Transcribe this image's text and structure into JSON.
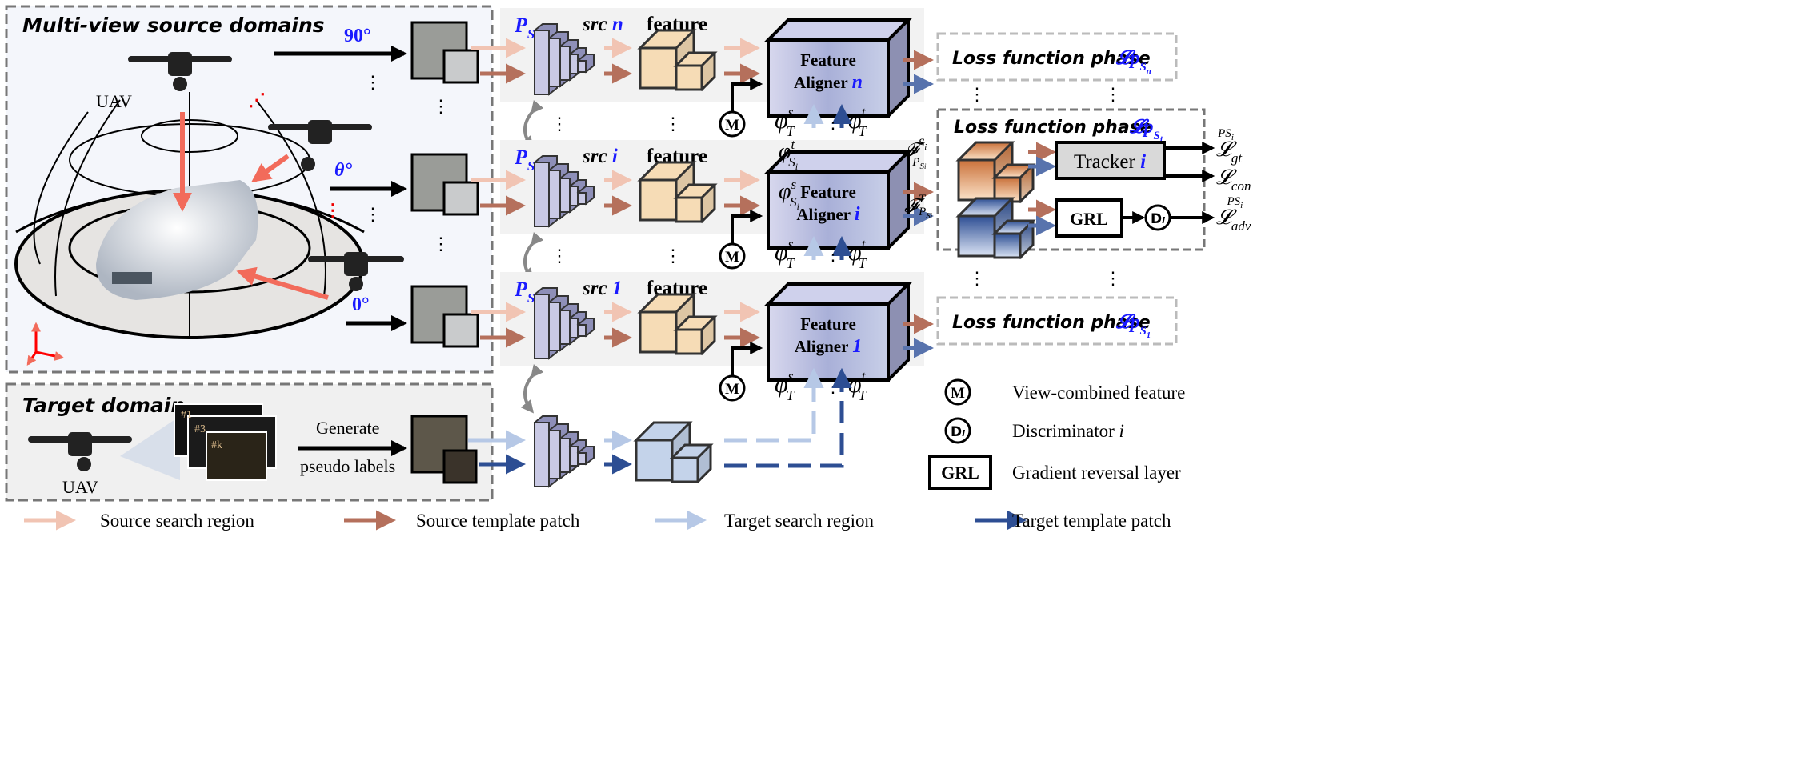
{
  "colors": {
    "source_search": "#f1c4b3",
    "source_template": "#b5705c",
    "target_search": "#b6c8e6",
    "target_template": "#2d4e93",
    "accent_text": "#1a1aff",
    "feature_cube": "#f6dcb6",
    "target_cube": "#c4d3ea",
    "aligner": "#b9bde0"
  },
  "source_panel": {
    "title": "Multi-view source domains",
    "uav_label": "UAV",
    "angles": [
      "90°",
      "θ°",
      "0°"
    ]
  },
  "target_panel": {
    "title": "Target domain",
    "uav_label": "UAV",
    "frames": [
      "#1",
      "#3",
      "#k"
    ],
    "generate_label": "Generate",
    "pseudo_label": "pseudo labels"
  },
  "rows": [
    {
      "p": "P",
      "p_sub": "S",
      "p_subsub": "n",
      "src": "src",
      "src_id": "n",
      "feature": "feature",
      "aligner_l1": "Feature",
      "aligner_l2": "Aligner",
      "aligner_id": "n",
      "loss_label": "Loss function phase",
      "loss_sym": "𝓛p",
      "loss_sub": "S",
      "loss_subsub": "n"
    },
    {
      "p": "P",
      "p_sub": "S",
      "p_subsub": "i",
      "src": "src",
      "src_id": "i",
      "feature": "feature",
      "aligner_l1": "Feature",
      "aligner_l2": "Aligner",
      "aligner_id": "i",
      "loss_label": "Loss function phase",
      "loss_sym": "𝓛p",
      "loss_sub": "S",
      "loss_subsub": "i"
    },
    {
      "p": "P",
      "p_sub": "S",
      "p_subsub": "1",
      "src": "src",
      "src_id": "1",
      "feature": "feature",
      "aligner_l1": "Feature",
      "aligner_l2": "Aligner",
      "aligner_id": "1",
      "loss_label": "Loss function phase",
      "loss_sym": "𝓛p",
      "loss_sub": "S",
      "loss_subsub": "1"
    }
  ],
  "aligner_inputs": {
    "phi": "φ",
    "sub": "T",
    "sup_s": "s",
    "sup_t": "t",
    "m": "M"
  },
  "row_i_phi": {
    "phi": "φ",
    "sub": "S",
    "subsub": "i",
    "sup_t": "t",
    "sup_s": "s"
  },
  "feature_out": {
    "F": "𝓕",
    "sup_s": "S",
    "sup_s_sub": "i",
    "sup_t": "T",
    "sub": "P",
    "sub_s": "S",
    "sub_s_sub": "i"
  },
  "loss_i": {
    "tracker": "Tracker",
    "tracker_id": "i",
    "grl": "GRL",
    "d": "D",
    "d_sub": "i",
    "outputs": [
      {
        "base": "𝓛",
        "sub": "gt",
        "sup": "PS",
        "sup_sub": "i"
      },
      {
        "base": "𝓛",
        "sub": "con",
        "sup": "",
        "sup_sub": ""
      },
      {
        "base": "𝓛",
        "sub": "adv",
        "sup": "PS",
        "sup_sub": "i"
      }
    ]
  },
  "key": {
    "m_symbol": "M",
    "m_label": "View-combined feature",
    "d_symbol": "D",
    "d_sub": "i",
    "d_label": "Discriminator",
    "d_id": "i",
    "grl_symbol": "GRL",
    "grl_label": "Gradient reversal layer"
  },
  "legend": [
    {
      "label": "Source search region",
      "color": "#f1c4b3"
    },
    {
      "label": "Source template patch",
      "color": "#b5705c"
    },
    {
      "label": "Target search region",
      "color": "#b6c8e6"
    },
    {
      "label": "Target template patch",
      "color": "#2d4e93"
    }
  ]
}
